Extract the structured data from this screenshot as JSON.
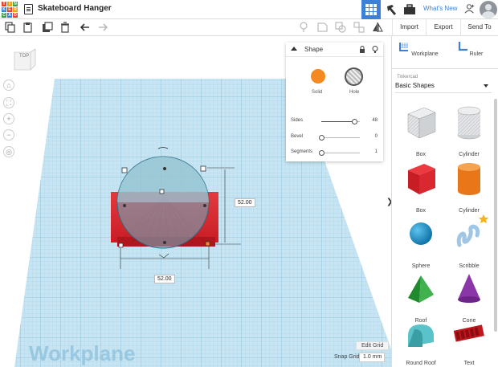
{
  "topbar": {
    "logo_letters": [
      "T",
      "I",
      "N",
      "K",
      "E",
      "R",
      "C",
      "A",
      "D"
    ],
    "logo_colors": [
      "#e8412c",
      "#f0a20b",
      "#3e9e4b",
      "#3d81d6",
      "#e8412c",
      "#f0a20b",
      "#3e9e4b",
      "#3d81d6",
      "#e8412c"
    ],
    "title": "Skateboard Hanger",
    "whats_new": "What's New",
    "icons": [
      "menu-icon",
      "grid-view-icon",
      "hammer-icon",
      "briefcase-icon",
      "add-user-icon",
      "avatar"
    ]
  },
  "toolbar": {
    "import_label": "Import",
    "export_label": "Export",
    "send_to_label": "Send To",
    "icons": [
      "copy-icon",
      "paste-icon",
      "duplicate-icon",
      "delete-icon",
      "undo-icon",
      "redo-icon",
      "light-icon",
      "note-icon",
      "group-icon",
      "ungroup-icon",
      "align-icon",
      "mirror-icon"
    ]
  },
  "workspace": {
    "viewcube_label": "TOP",
    "workplane_label": "Workplane",
    "edit_grid_label": "Edit Grid",
    "snap_grid_label": "Snap Grid",
    "snap_grid_value": "1.0 mm",
    "dim_height": "52.00",
    "dim_width": "52.00",
    "colors": {
      "grid": "#bfe0ef",
      "grid_line": "#8fc3dc",
      "box": "#d8232c",
      "hole": "#7fb3c4"
    }
  },
  "shape_panel": {
    "title": "Shape",
    "solid_label": "Solid",
    "hole_label": "Hole",
    "sliders": [
      {
        "label": "Sides",
        "value": "48",
        "fraction": 0.85
      },
      {
        "label": "Bevel",
        "value": "0",
        "fraction": 0
      },
      {
        "label": "Segments",
        "value": "1",
        "fraction": 0
      }
    ]
  },
  "right_panel": {
    "workplane_label": "Workplane",
    "ruler_label": "Ruler",
    "library_small": "Tinkercad",
    "library_name": "Basic Shapes",
    "shapes": [
      {
        "name": "Box"
      },
      {
        "name": "Cylinder"
      },
      {
        "name": "Box"
      },
      {
        "name": "Cylinder"
      },
      {
        "name": "Sphere"
      },
      {
        "name": "Scribble"
      },
      {
        "name": "Roof"
      },
      {
        "name": "Cone"
      },
      {
        "name": "Round Roof"
      },
      {
        "name": "Text"
      }
    ]
  }
}
